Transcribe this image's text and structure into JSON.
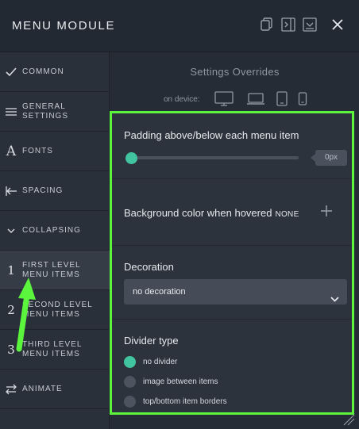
{
  "header": {
    "title": "MENU MODULE",
    "icons": [
      "copy-icon",
      "sidebar-toggle-icon",
      "save-icon",
      "close-icon"
    ]
  },
  "sidebar": {
    "items": [
      {
        "label": "COMMON",
        "icon": "check-icon"
      },
      {
        "label": "GENERAL SETTINGS",
        "icon": "menu-lines-icon"
      },
      {
        "label": "FONTS",
        "icon": "font-icon"
      },
      {
        "label": "SPACING",
        "icon": "arrow-left-bar-icon"
      },
      {
        "label": "COLLAPSING",
        "icon": "chevron-down-icon"
      },
      {
        "label": "FIRST LEVEL MENU ITEMS",
        "number": "1",
        "active": true
      },
      {
        "label": "SECOND LEVEL MENU ITEMS",
        "number": "2"
      },
      {
        "label": "THIRD LEVEL MENU ITEMS",
        "number": "3"
      },
      {
        "label": "ANIMATE",
        "icon": "swap-arrows-icon"
      }
    ]
  },
  "main": {
    "overrides_title": "Settings Overrides",
    "device_label": "on device:",
    "devices": [
      "desktop-icon",
      "laptop-icon",
      "tablet-icon",
      "phone-icon"
    ]
  },
  "panel": {
    "padding": {
      "label": "Padding above/below each menu item",
      "value_text": "0px",
      "value_fraction": 0
    },
    "background": {
      "label": "Background color when hovered",
      "value": "NONE"
    },
    "decoration": {
      "label": "Decoration",
      "selected": "no decoration"
    },
    "divider": {
      "label": "Divider type",
      "options": [
        {
          "label": "no divider",
          "selected": true
        },
        {
          "label": "image between items",
          "selected": false
        },
        {
          "label": "top/bottom item borders",
          "selected": false
        }
      ]
    }
  },
  "colors": {
    "highlight_border": "#5af53c",
    "accent": "#40c5a0",
    "background": "#262c35"
  }
}
